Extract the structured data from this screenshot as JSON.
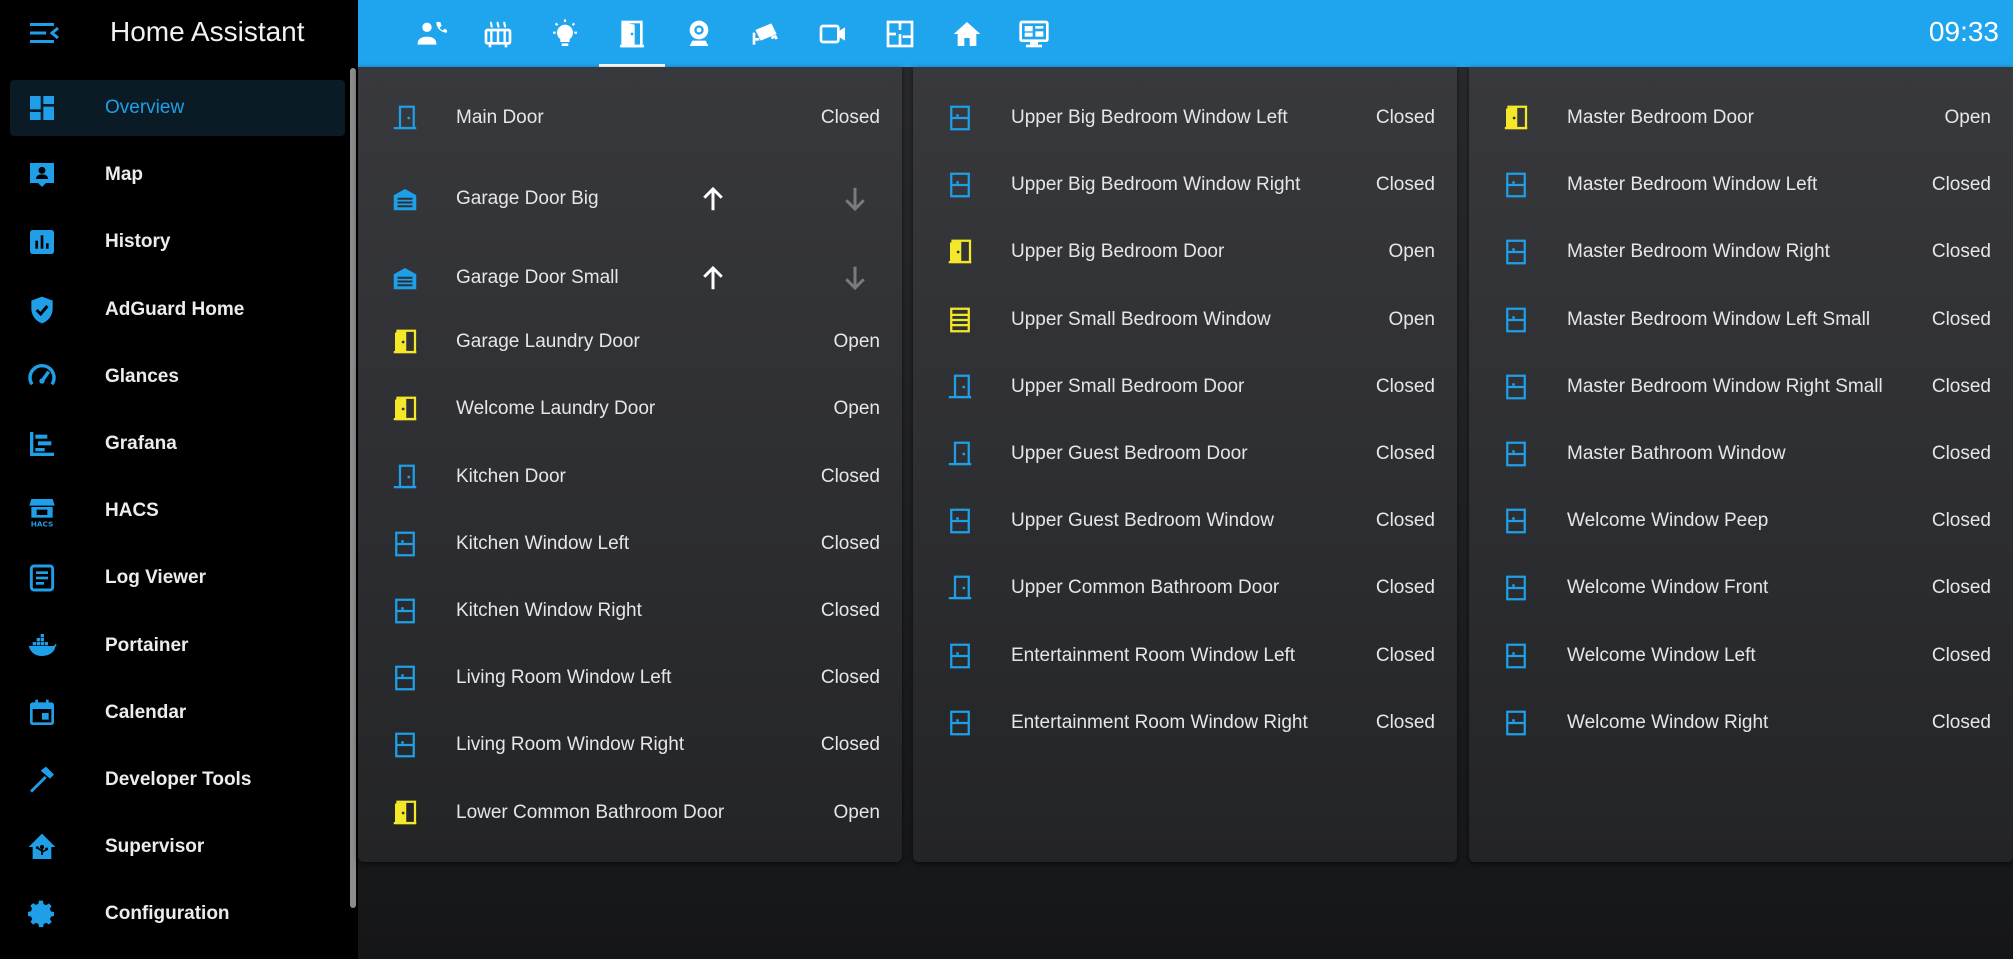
{
  "app": {
    "title": "Home Assistant"
  },
  "clock": "09:33",
  "colors": {
    "accent": "#1fa4ee",
    "icon_blue": "#1e9fe8",
    "icon_yellow": "#f5e829",
    "active_nav_bg": "#0b1b26"
  },
  "sidebar": {
    "items": [
      {
        "label": "Overview",
        "icon": "view-dashboard-icon"
      },
      {
        "label": "Map",
        "icon": "map-account-icon"
      },
      {
        "label": "History",
        "icon": "chart-box-icon"
      },
      {
        "label": "AdGuard Home",
        "icon": "shield-check-icon"
      },
      {
        "label": "Glances",
        "icon": "speedometer-icon"
      },
      {
        "label": "Grafana",
        "icon": "chart-timeline-icon"
      },
      {
        "label": "HACS",
        "icon": "hacs-store-icon"
      },
      {
        "label": "Log Viewer",
        "icon": "text-box-icon"
      },
      {
        "label": "Portainer",
        "icon": "docker-icon"
      },
      {
        "label": "Calendar",
        "icon": "calendar-icon"
      },
      {
        "label": "Developer Tools",
        "icon": "hammer-icon"
      },
      {
        "label": "Supervisor",
        "icon": "home-assistant-icon"
      },
      {
        "label": "Configuration",
        "icon": "cog-icon"
      }
    ]
  },
  "tabs": [
    {
      "icon": "account-phone-icon"
    },
    {
      "icon": "radiator-icon"
    },
    {
      "icon": "lightbulb-icon"
    },
    {
      "icon": "door-icon",
      "active": true
    },
    {
      "icon": "webcam-icon"
    },
    {
      "icon": "cctv-icon"
    },
    {
      "icon": "video-icon"
    },
    {
      "icon": "floor-plan-icon"
    },
    {
      "icon": "home-icon"
    },
    {
      "icon": "monitor-dashboard-icon"
    }
  ],
  "cards": [
    {
      "rows": [
        {
          "name": "Main Door",
          "state": "Closed",
          "icon": "door-closed-icon",
          "color": "blue"
        },
        {
          "name": "Garage Door Big",
          "state": "",
          "icon": "garage-icon",
          "color": "blue",
          "cover": true
        },
        {
          "name": "Garage Door Small",
          "state": "",
          "icon": "garage-icon",
          "color": "blue",
          "cover": true
        },
        {
          "name": "Garage Laundry Door",
          "state": "Open",
          "icon": "door-open-icon",
          "color": "yellow"
        },
        {
          "name": "Welcome Laundry Door",
          "state": "Open",
          "icon": "door-open-icon",
          "color": "yellow"
        },
        {
          "name": "Kitchen Door",
          "state": "Closed",
          "icon": "door-closed-icon",
          "color": "blue"
        },
        {
          "name": "Kitchen Window Left",
          "state": "Closed",
          "icon": "window-closed-icon",
          "color": "blue"
        },
        {
          "name": "Kitchen Window Right",
          "state": "Closed",
          "icon": "window-closed-icon",
          "color": "blue"
        },
        {
          "name": "Living Room Window Left",
          "state": "Closed",
          "icon": "window-closed-icon",
          "color": "blue"
        },
        {
          "name": "Living Room Window Right",
          "state": "Closed",
          "icon": "window-closed-icon",
          "color": "blue"
        },
        {
          "name": "Lower Common Bathroom Door",
          "state": "Open",
          "icon": "door-open-icon",
          "color": "yellow"
        }
      ]
    },
    {
      "rows": [
        {
          "name": "Upper Big Bedroom Window Left",
          "state": "Closed",
          "icon": "window-closed-icon",
          "color": "blue"
        },
        {
          "name": "Upper Big Bedroom Window Right",
          "state": "Closed",
          "icon": "window-closed-icon",
          "color": "blue"
        },
        {
          "name": "Upper Big Bedroom Door",
          "state": "Open",
          "icon": "door-open-icon",
          "color": "yellow"
        },
        {
          "name": "Upper Small Bedroom Window",
          "state": "Open",
          "icon": "window-open-icon",
          "color": "yellow"
        },
        {
          "name": "Upper Small Bedroom Door",
          "state": "Closed",
          "icon": "door-closed-icon",
          "color": "blue"
        },
        {
          "name": "Upper Guest Bedroom Door",
          "state": "Closed",
          "icon": "door-closed-icon",
          "color": "blue"
        },
        {
          "name": "Upper Guest Bedroom Window",
          "state": "Closed",
          "icon": "window-closed-icon",
          "color": "blue"
        },
        {
          "name": "Upper Common Bathroom Door",
          "state": "Closed",
          "icon": "door-closed-icon",
          "color": "blue"
        },
        {
          "name": "Entertainment Room Window Left",
          "state": "Closed",
          "icon": "window-closed-icon",
          "color": "blue"
        },
        {
          "name": "Entertainment Room Window Right",
          "state": "Closed",
          "icon": "window-closed-icon",
          "color": "blue"
        }
      ]
    },
    {
      "rows": [
        {
          "name": "Master Bedroom Door",
          "state": "Open",
          "icon": "door-open-icon",
          "color": "yellow"
        },
        {
          "name": "Master Bedroom Window Left",
          "state": "Closed",
          "icon": "window-closed-icon",
          "color": "blue"
        },
        {
          "name": "Master Bedroom Window Right",
          "state": "Closed",
          "icon": "window-closed-icon",
          "color": "blue"
        },
        {
          "name": "Master Bedroom Window Left Small",
          "state": "Closed",
          "icon": "window-closed-icon",
          "color": "blue"
        },
        {
          "name": "Master Bedroom Window Right Small",
          "state": "Closed",
          "icon": "window-closed-icon",
          "color": "blue"
        },
        {
          "name": "Master Bathroom Window",
          "state": "Closed",
          "icon": "window-closed-icon",
          "color": "blue"
        },
        {
          "name": "Welcome Window Peep",
          "state": "Closed",
          "icon": "window-closed-icon",
          "color": "blue"
        },
        {
          "name": "Welcome Window Front",
          "state": "Closed",
          "icon": "window-closed-icon",
          "color": "blue"
        },
        {
          "name": "Welcome Window Left",
          "state": "Closed",
          "icon": "window-closed-icon",
          "color": "blue"
        },
        {
          "name": "Welcome Window Right",
          "state": "Closed",
          "icon": "window-closed-icon",
          "color": "blue"
        }
      ]
    }
  ]
}
